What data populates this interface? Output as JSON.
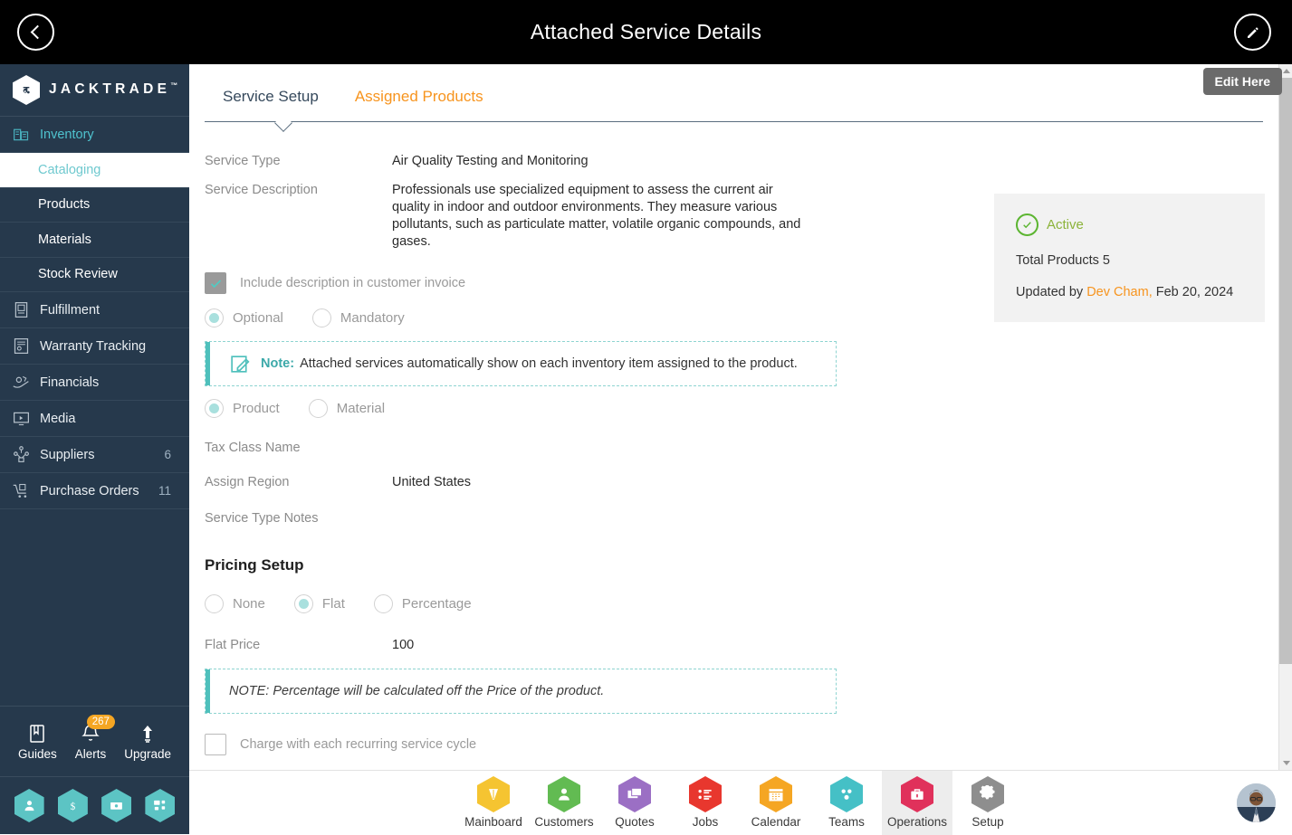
{
  "header": {
    "title": "Attached Service Details",
    "back_icon": "chevron-left-icon",
    "edit_icon": "pencil-icon"
  },
  "tooltip": {
    "text": "Edit Here"
  },
  "sidebar": {
    "brand": {
      "name": "JACKTRADE",
      "tm": "™",
      "mark": "JC"
    },
    "items": [
      {
        "label": "Inventory",
        "icon": "inventory-icon",
        "count": "",
        "active": true
      },
      {
        "label": "Fulfillment",
        "icon": "fulfillment-icon",
        "count": ""
      },
      {
        "label": "Warranty Tracking",
        "icon": "warranty-icon",
        "count": ""
      },
      {
        "label": "Financials",
        "icon": "financials-icon",
        "count": ""
      },
      {
        "label": "Media",
        "icon": "media-icon",
        "count": ""
      },
      {
        "label": "Suppliers",
        "icon": "suppliers-icon",
        "count": "6"
      },
      {
        "label": "Purchase Orders",
        "icon": "purchase-orders-icon",
        "count": "11"
      }
    ],
    "sub_items": [
      {
        "label": "Cataloging",
        "selected": true
      },
      {
        "label": "Products",
        "selected": false
      },
      {
        "label": "Materials",
        "selected": false
      },
      {
        "label": "Stock Review",
        "selected": false
      }
    ],
    "tools": [
      {
        "label": "Guides",
        "icon": "book-icon",
        "badge": ""
      },
      {
        "label": "Alerts",
        "icon": "bell-icon",
        "badge": "267"
      },
      {
        "label": "Upgrade",
        "icon": "up-arrow-icon",
        "badge": ""
      }
    ],
    "quick_icons": [
      "user-icon",
      "dollar-icon",
      "invoice-icon",
      "workflow-icon"
    ]
  },
  "tabs": [
    {
      "label": "Service Setup",
      "active": true
    },
    {
      "label": "Assigned Products",
      "active": false
    }
  ],
  "form": {
    "service_type_label": "Service Type",
    "service_type_value": "Air Quality Testing and Monitoring",
    "service_description_label": "Service Description",
    "service_description_value": "Professionals use specialized equipment to assess the current air quality in indoor and outdoor environments. They measure various pollutants, such as particulate matter, volatile organic compounds, and gases.",
    "include_description_label": "Include description in customer invoice",
    "include_description_checked": true,
    "requirement_options": [
      {
        "label": "Optional",
        "selected": true
      },
      {
        "label": "Mandatory",
        "selected": false
      }
    ],
    "note_prefix": "Note:",
    "note_text": "Attached services automatically show on each inventory item assigned to the product.",
    "target_options": [
      {
        "label": "Product",
        "selected": true
      },
      {
        "label": "Material",
        "selected": false
      }
    ],
    "tax_class_label": "Tax Class Name",
    "tax_class_value": "",
    "assign_region_label": "Assign Region",
    "assign_region_value": "United States",
    "service_type_notes_label": "Service Type Notes",
    "service_type_notes_value": ""
  },
  "pricing": {
    "title": "Pricing Setup",
    "options": [
      {
        "label": "None",
        "selected": false
      },
      {
        "label": "Flat",
        "selected": true
      },
      {
        "label": "Percentage",
        "selected": false
      }
    ],
    "flat_price_label": "Flat Price",
    "flat_price_value": "100",
    "note_text": "NOTE: Percentage will be calculated off the Price of the product.",
    "recurring_label": "Charge with each recurring service cycle",
    "recurring_checked": false
  },
  "status_card": {
    "status": "Active",
    "status_icon": "check-circle-icon",
    "total_products_label": "Total Products 5",
    "updated_prefix": "Updated by",
    "updated_user": "Dev Cham,",
    "updated_date": "Feb 20, 2024"
  },
  "bottom_nav": {
    "items": [
      {
        "label": "Mainboard",
        "icon": "mainboard-icon",
        "color": "#f5c431",
        "current": false
      },
      {
        "label": "Customers",
        "icon": "customers-icon",
        "color": "#62bb52",
        "current": false
      },
      {
        "label": "Quotes",
        "icon": "quotes-icon",
        "color": "#9b6fc4",
        "current": false
      },
      {
        "label": "Jobs",
        "icon": "jobs-icon",
        "color": "#e8372e",
        "current": false
      },
      {
        "label": "Calendar",
        "icon": "calendar-icon",
        "color": "#f5a623",
        "current": false
      },
      {
        "label": "Teams",
        "icon": "teams-icon",
        "color": "#45c0c6",
        "current": false
      },
      {
        "label": "Operations",
        "icon": "operations-icon",
        "color": "#e0315b",
        "current": true
      },
      {
        "label": "Setup",
        "icon": "gear-icon",
        "color": "#8e8e8e",
        "current": false
      }
    ],
    "avatar_icon": "user-avatar"
  },
  "colors": {
    "topbar": "#000000",
    "sidebar": "#26394c",
    "accent_teal": "#4fc3cf",
    "accent_orange": "#f7941e",
    "status_green": "#8cb33a"
  }
}
